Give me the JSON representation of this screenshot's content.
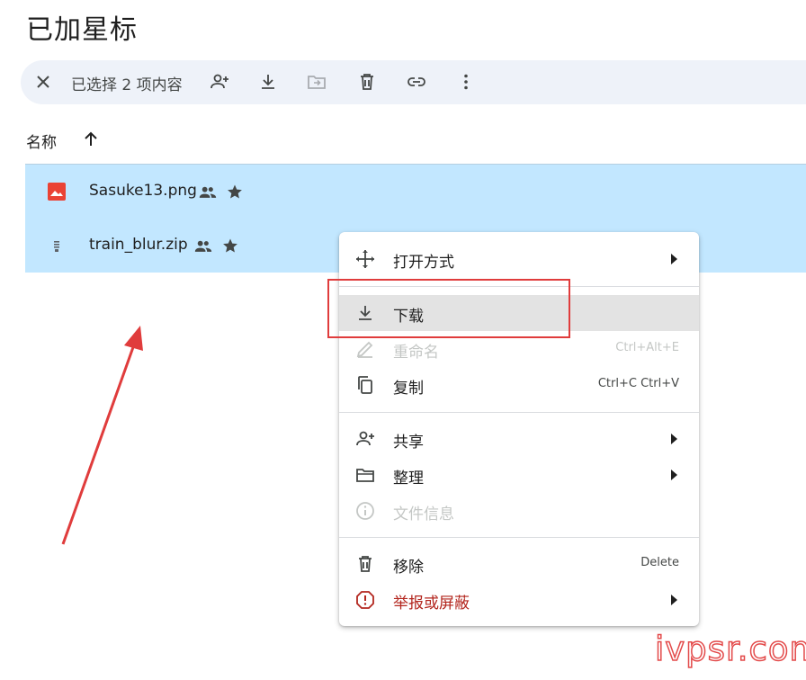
{
  "page": {
    "title": "已加星标"
  },
  "toolbar": {
    "selection_text": "已选择 2 项内容",
    "actions": [
      "close-icon",
      "share-icon",
      "download-icon",
      "move-icon",
      "delete-icon",
      "link-icon",
      "more-vert-icon"
    ]
  },
  "list_header": {
    "name_label": "名称",
    "sort": "ascending"
  },
  "files": [
    {
      "name": "Sasuke13.png",
      "type": "image",
      "shared": true,
      "starred": true
    },
    {
      "name": "train_blur.zip",
      "type": "archive",
      "shared": true,
      "starred": true
    }
  ],
  "context_menu": {
    "items": [
      {
        "label": "打开方式",
        "icon": "open-with-icon",
        "submenu": true
      },
      {
        "label": "下载",
        "icon": "download-icon",
        "highlighted": true
      },
      {
        "label": "重命名",
        "icon": "rename-icon",
        "shortcut": "Ctrl+Alt+E",
        "disabled": true
      },
      {
        "label": "复制",
        "icon": "copy-icon",
        "shortcut": "Ctrl+C Ctrl+V"
      },
      {
        "label": "共享",
        "icon": "share-icon",
        "submenu": true
      },
      {
        "label": "整理",
        "icon": "folder-icon",
        "submenu": true
      },
      {
        "label": "文件信息",
        "icon": "info-icon",
        "disabled": true
      },
      {
        "label": "移除",
        "icon": "trash-icon",
        "shortcut": "Delete"
      },
      {
        "label": "举报或屏蔽",
        "icon": "report-icon",
        "submenu": true,
        "danger": true
      }
    ]
  },
  "colors": {
    "selection": "#c2e7ff",
    "toolbar": "#eef2f9",
    "highlight": "#e3e3e3",
    "annotation": "#e03c3c",
    "danger": "#b3261e"
  },
  "watermark": "ivpsr.com"
}
